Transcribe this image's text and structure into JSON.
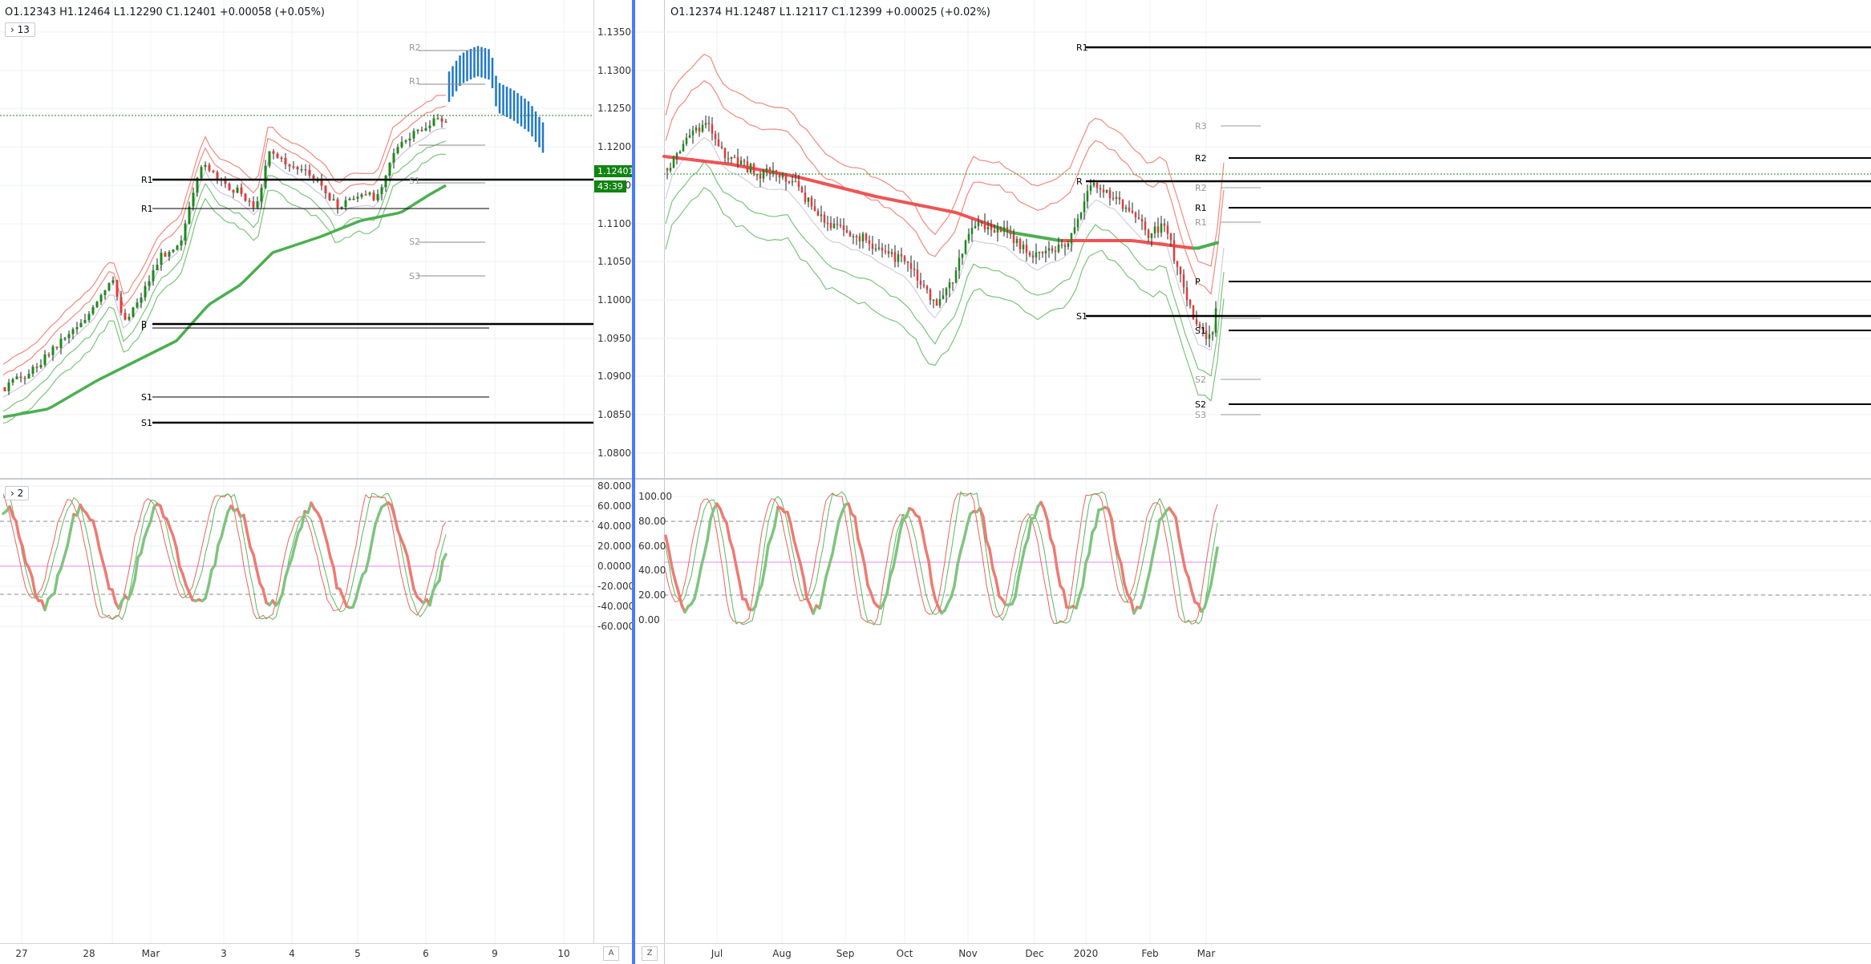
{
  "left": {
    "ohlc": "O1.12343  H1.12464  L1.12290  C1.12401  +0.00058 (+0.05%)",
    "indicator_toggle": "13",
    "osc_toggle": "2",
    "price_ticks": [
      "1.13500",
      "1.13000",
      "1.12500",
      "1.12000",
      "1.11500",
      "1.11000",
      "1.10500",
      "1.10000",
      "1.09500",
      "1.09000",
      "1.08500",
      "1.08000"
    ],
    "osc_ticks": [
      "80.000000",
      "60.000000",
      "40.000000",
      "20.000000",
      "0.000000",
      "-20.000000",
      "-40.000000",
      "-60.000000"
    ],
    "x_labels": [
      "27",
      "28",
      "Mar",
      "3",
      "4",
      "5",
      "6",
      "9",
      "10"
    ],
    "last_price": "1.12401",
    "countdown": "43:39",
    "pivot_labels": [
      "R2",
      "R1",
      "S1",
      "S2",
      "S3",
      "R1",
      "R1",
      "P",
      "P",
      "S1",
      "S1"
    ],
    "axis_corner": "A"
  },
  "right": {
    "ohlc": "O1.12374  H1.12487  L1.12117  C1.12399  +0.00025 (+0.02%)",
    "osc_ticks": [
      "100.00",
      "80.00",
      "60.00",
      "40.00",
      "20.00",
      "0.00"
    ],
    "x_labels": [
      "Jul",
      "Aug",
      "Sep",
      "Oct",
      "Nov",
      "Dec",
      "2020",
      "Feb",
      "Mar"
    ],
    "pivot_labels": [
      "R1",
      "R3",
      "R2",
      "R",
      "R2",
      "R1",
      "R1",
      "P",
      "S1",
      "S1",
      "S2",
      "S2",
      "S3"
    ],
    "axis_corner": "Z"
  },
  "colors": {
    "up": "#1b8a1b",
    "down": "#e23b3b",
    "projection": "#1f78c8",
    "band_red": "#f08a80",
    "band_green": "#7cc47c",
    "ma_green": "#4caf50",
    "ma_red": "#ee5555",
    "grid": "#eef0f3"
  }
}
